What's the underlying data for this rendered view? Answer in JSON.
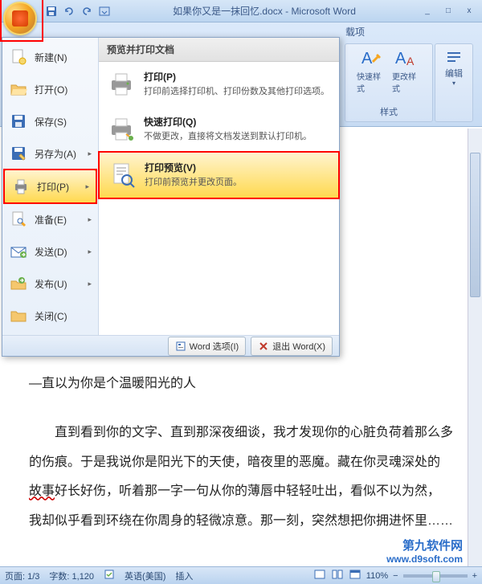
{
  "window": {
    "title": "如果你又是一抹回忆.docx - Microsoft Word",
    "minimize": "_",
    "maximize": "□",
    "close": "x"
  },
  "ribbon": {
    "tab_addin": "载项",
    "quick_style": "快速样式",
    "change_style": "更改样式",
    "edit": "编辑",
    "group_style": "样式"
  },
  "office_menu": {
    "items": [
      {
        "icon": "new",
        "label": "新建(N)"
      },
      {
        "icon": "open",
        "label": "打开(O)"
      },
      {
        "icon": "save",
        "label": "保存(S)"
      },
      {
        "icon": "saveas",
        "label": "另存为(A)",
        "arrow": true
      },
      {
        "icon": "print",
        "label": "打印(P)",
        "arrow": true,
        "active": true
      },
      {
        "icon": "prepare",
        "label": "准备(E)",
        "arrow": true
      },
      {
        "icon": "send",
        "label": "发送(D)",
        "arrow": true
      },
      {
        "icon": "publish",
        "label": "发布(U)",
        "arrow": true
      },
      {
        "icon": "close",
        "label": "关闭(C)"
      }
    ],
    "submenu_header": "预览并打印文档",
    "submenu": [
      {
        "title": "打印(P)",
        "desc": "打印前选择打印机、打印份数及其他打印选项。"
      },
      {
        "title": "快速打印(Q)",
        "desc": "不做更改，直接将文档发送到默认打印机。"
      },
      {
        "title": "打印预览(V)",
        "desc": "打印前预览并更改页面。",
        "highlighted": true
      }
    ],
    "footer": {
      "word_options": "Word 选项(I)",
      "exit_word": "退出 Word(X)"
    }
  },
  "document": {
    "line1": "—直以为你是个温暖阳光的人",
    "para": "直到看到你的文字、直到那深夜细谈，我才发现你的心脏负荷着那么多的伤痕。于是我说你是阳光下的天使，暗夜里的恶魔。藏在你灵魂深处的",
    "para_wavy": "故事",
    "para2": "好长好伤，听着那一字一句从你的薄唇中轻轻吐出，看似不以为然，我却似乎看到环绕在你周身的轻微凉意。那一刻，突然想把你拥进怀里……"
  },
  "status": {
    "page": "页面: 1/3",
    "words": "字数: 1,120",
    "prooflang": "",
    "lang": "英语(美国)",
    "insert": "插入",
    "zoom": "110%"
  },
  "watermark": {
    "line1": "第九软件网",
    "line2": "www.d9soft.com"
  }
}
